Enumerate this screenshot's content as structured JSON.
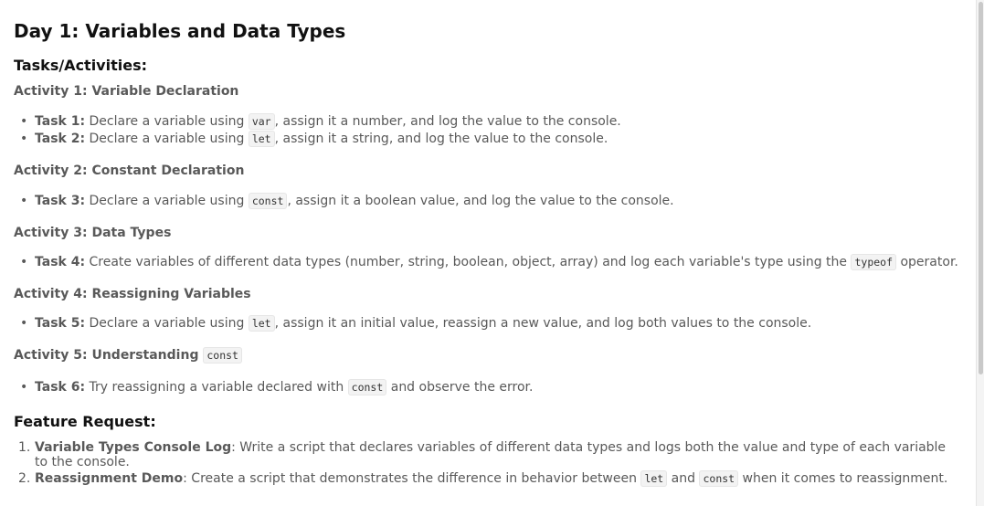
{
  "title": "Day 1: Variables and Data Types",
  "tasks_heading": "Tasks/Activities:",
  "activities": [
    {
      "heading": "Activity 1: Variable Declaration",
      "tasks": [
        {
          "label": "Task 1",
          "pre": "Declare a variable using",
          "code": "var",
          "post": ", assign it a number, and log the value to the console."
        },
        {
          "label": "Task 2",
          "pre": "Declare a variable using",
          "code": "let",
          "post": ", assign it a string, and log the value to the console."
        }
      ]
    },
    {
      "heading": "Activity 2: Constant Declaration",
      "tasks": [
        {
          "label": "Task 3",
          "pre": "Declare a variable using",
          "code": "const",
          "post": ", assign it a boolean value, and log the value to the console."
        }
      ]
    },
    {
      "heading": "Activity 3: Data Types",
      "tasks": [
        {
          "label": "Task 4",
          "pre": "Create variables of different data types (number, string, boolean, object, array) and log each variable's type using the",
          "code": "typeof",
          "post": "operator."
        }
      ]
    },
    {
      "heading": "Activity 4: Reassigning Variables",
      "tasks": [
        {
          "label": "Task 5",
          "pre": "Declare a variable using",
          "code": "let",
          "post": ", assign it an initial value, reassign a new value, and log both values to the console."
        }
      ]
    },
    {
      "heading": "Activity 5: Understanding",
      "heading_code": "const",
      "tasks": [
        {
          "label": "Task 6",
          "pre": "Try reassigning a variable declared with",
          "code": "const",
          "post": "and observe the error."
        }
      ]
    }
  ],
  "feature_heading": "Feature Request:",
  "features": [
    {
      "num": "1.",
      "label": "Variable Types Console Log",
      "text": ": Write a script that declares variables of different data types and logs both the value and type of each variable to the console."
    },
    {
      "num": "2.",
      "label": "Reassignment Demo",
      "pre": ": Create a script that demonstrates the difference in behavior between",
      "code1": "let",
      "mid": "and",
      "code2": "const",
      "post": "when it comes to reassignment."
    }
  ],
  "task_separator": ":",
  "bullet": "•"
}
